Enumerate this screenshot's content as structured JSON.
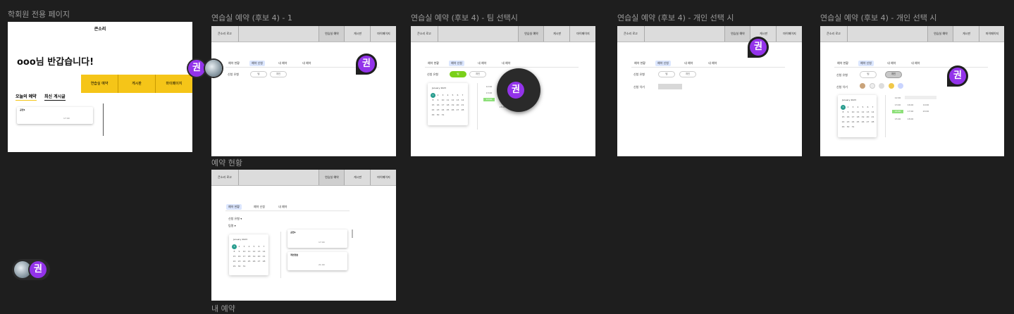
{
  "frame1": {
    "label": "학회원 전용 페이지",
    "brand": "큰소리",
    "greeting": "ooo님 반갑습니다!",
    "buttons": [
      "연습실 예약",
      "게시판",
      "마이페이지"
    ],
    "tabs": [
      "오늘의 예약",
      "최신 게시글"
    ],
    "card": {
      "title": "공연1",
      "time": "17:00"
    }
  },
  "frame2": {
    "label": "연습실 예약 (후보 4) - 1",
    "tabs": [
      "예약 현황",
      "예약 신청",
      "내 예약",
      "내 예약"
    ],
    "type_label": "신청 유형",
    "options": [
      "팀",
      "개인"
    ]
  },
  "frame3": {
    "label": "연습실 예약 (후보 4) - 팀 선택시",
    "tabs": [
      "예약 현황",
      "예약 신청",
      "내 예약",
      "내 예약"
    ],
    "type_label": "신청 유형",
    "options": [
      "팀",
      "개인"
    ],
    "cal_month": "January 2023",
    "slots": [
      "12:00",
      "13:00",
      "14:00",
      "15:00"
    ]
  },
  "frame4": {
    "label": "연습실 예약 (후보 4) - 개인 선택 시",
    "tabs": [
      "예약 현황",
      "예약 신청",
      "내 예약",
      "내 예약"
    ],
    "type_label": "신청 유형",
    "target_label": "신청 악기",
    "options": [
      "팀",
      "개인"
    ]
  },
  "frame5": {
    "label": "연습실 예약 (후보 4) - 개인 선택 시",
    "tabs": [
      "예약 현황",
      "예약 신청",
      "내 예약",
      "내 예약"
    ],
    "type_label": "신청 유형",
    "target_label": "신청 악기",
    "options": [
      "팀",
      "개인"
    ],
    "cal_month": "January 2023",
    "slots": [
      "12:00",
      "13:00",
      "14:00",
      "15:00",
      "16:00",
      "17:00",
      "18:00",
      "19:00",
      "20:00",
      "21:00",
      "22:00",
      "23:00"
    ]
  },
  "frame6": {
    "label": "예약 현황",
    "tabs": [
      "예약 현황",
      "예약 신청",
      "내 예약"
    ],
    "filter1": "신청 유형 ▾",
    "filter2": "팀명 ▾",
    "cal_month": "January 2023",
    "cards": [
      {
        "title": "공연1",
        "time": "17:00"
      },
      {
        "title": "개인연습",
        "time": "21:00"
      }
    ]
  },
  "frame7": {
    "label": "내 예약"
  },
  "nav": {
    "logo": "큰소리 로고",
    "items": [
      "연습실 예약",
      "게시판",
      "마이페이지"
    ]
  },
  "cal_days": [
    "1",
    "2",
    "3",
    "4",
    "5",
    "6",
    "7",
    "8",
    "9",
    "10",
    "11",
    "12",
    "13",
    "14",
    "15",
    "16",
    "17",
    "18",
    "19",
    "20",
    "21",
    "22",
    "23",
    "24",
    "25",
    "26",
    "27",
    "28",
    "29",
    "30",
    "31"
  ],
  "avatar_text": "권",
  "colors": {
    "background": "#1e1e1e",
    "accent": "#f5c518",
    "avatar": "#9333ea",
    "tab_selected": "#dbe6ff",
    "team_pill": "#7ad01a"
  }
}
